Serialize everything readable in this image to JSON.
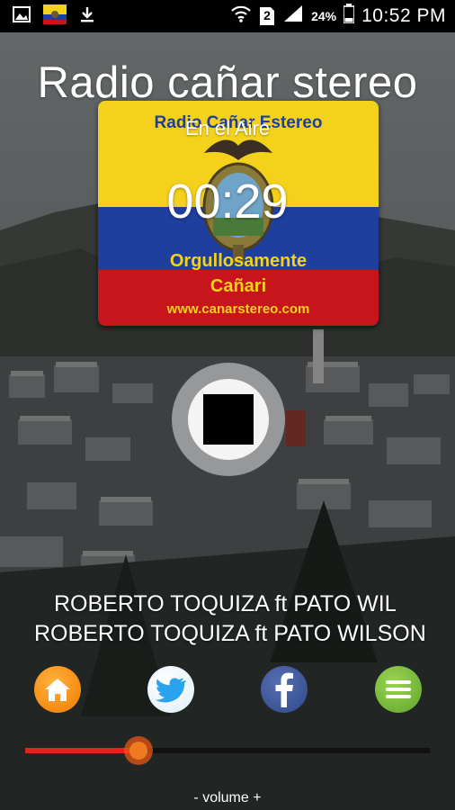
{
  "status_bar": {
    "time": "10:52 PM",
    "battery": "24%",
    "sim_slot": "2",
    "icons": [
      "gallery-icon",
      "ecuador-flag-icon",
      "download-icon",
      "wifi-icon",
      "sim-icon",
      "signal-icon",
      "battery-icon"
    ]
  },
  "station": {
    "title": "Radio cañar stereo",
    "status": "En el Aire",
    "timer": "00:29"
  },
  "logo": {
    "top_text": "Radio Cañar Estereo",
    "middle_text": "Orgullosamente",
    "bottom_text": "Cañari",
    "url_text": "www.canarstereo.com",
    "colors": {
      "yellow": "#f4d21c",
      "blue": "#1f3f9e",
      "red": "#c8151c"
    }
  },
  "player": {
    "control_icon": "stop-icon"
  },
  "now_playing": {
    "line1": "ROBERTO TOQUIZA ft PATO WILSON",
    "line2": "ROBERTO TOQUIZA ft PATO WILSON"
  },
  "social": [
    {
      "name": "home-icon",
      "color": "#f68a0f"
    },
    {
      "name": "twitter-icon",
      "color": "#2aa3ef"
    },
    {
      "name": "facebook-icon",
      "color": "#3b5998"
    },
    {
      "name": "menu-icon",
      "color": "#7dbf3c"
    }
  ],
  "volume": {
    "label": "- volume +",
    "level": 0.28,
    "color": "#e2241c"
  }
}
